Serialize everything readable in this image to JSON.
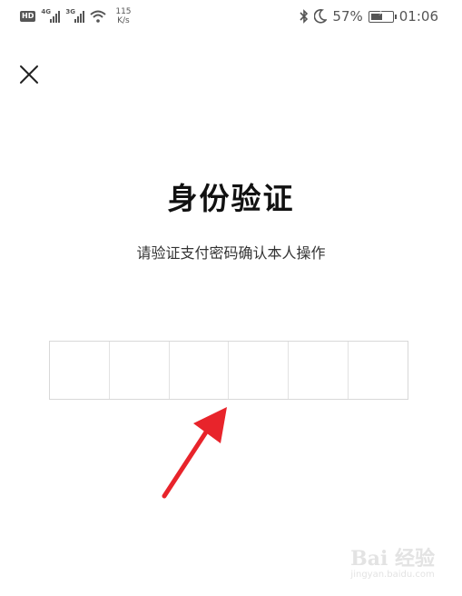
{
  "status_bar": {
    "hd_badge": "HD",
    "network_1": "4G",
    "network_2": "3G",
    "speed_value": "115",
    "speed_unit": "K/s",
    "battery": "57%",
    "time": "01:06",
    "battery_level_percent": 57
  },
  "header": {
    "close_icon": "close-icon"
  },
  "main": {
    "title": "身份验证",
    "subtitle": "请验证支付密码确认本人操作",
    "pin_length": 6
  },
  "watermark": {
    "logo_text": "Bai 经验",
    "url": "jingyan.baidu.com"
  },
  "colors": {
    "arrow": "#e8242b",
    "border": "#d8d8d8"
  }
}
